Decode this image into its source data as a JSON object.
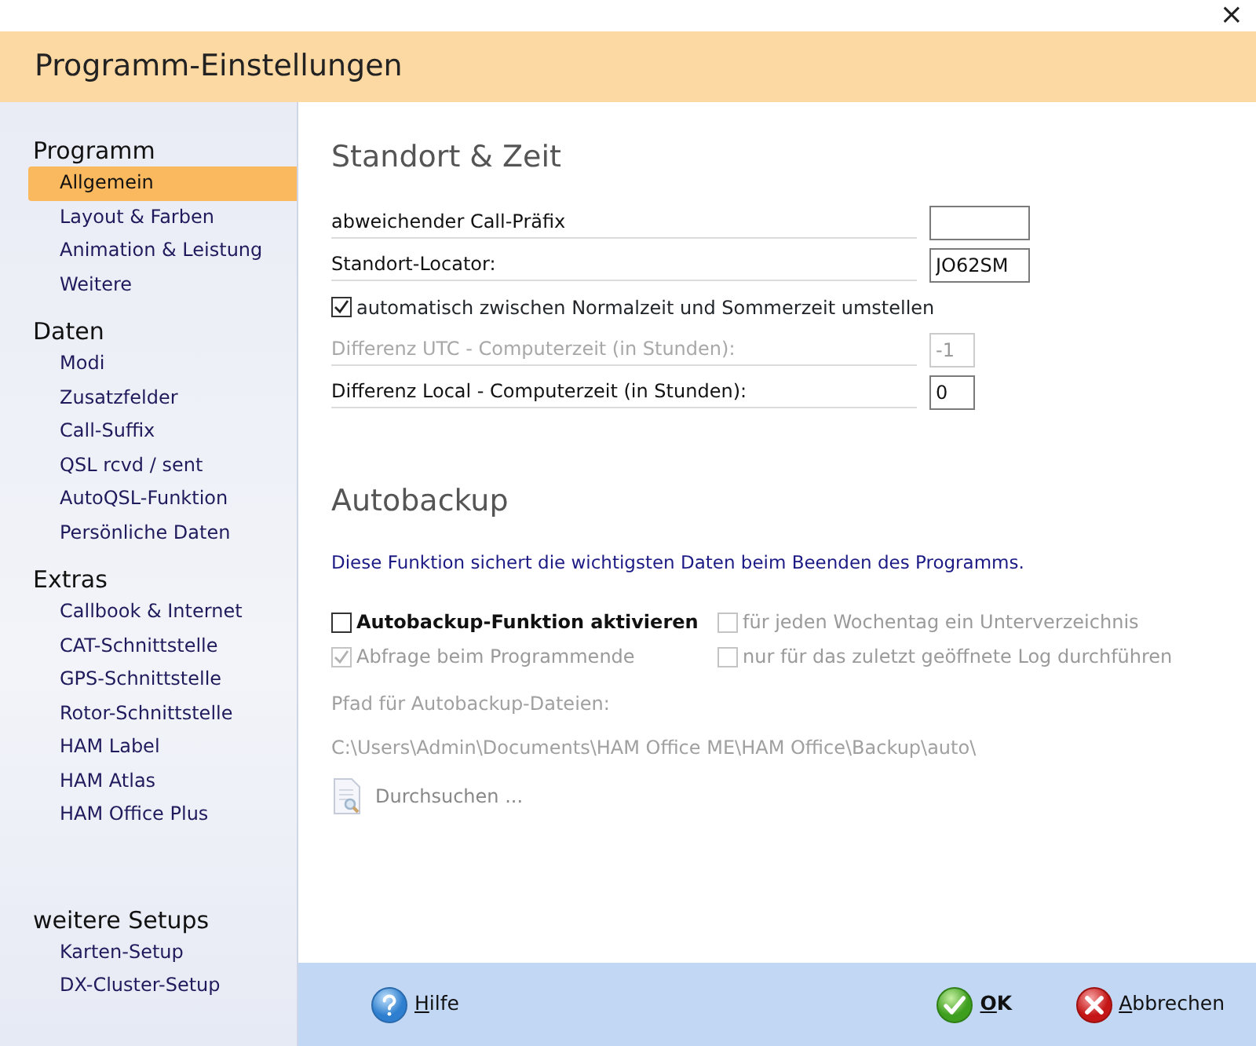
{
  "window": {
    "close_glyph": "×",
    "title": "Programm-Einstellungen"
  },
  "sidebar": {
    "groups": [
      {
        "heading": "Programm",
        "items": [
          {
            "label": "Allgemein",
            "selected": true
          },
          {
            "label": "Layout & Farben",
            "selected": false
          },
          {
            "label": "Animation & Leistung",
            "selected": false
          },
          {
            "label": "Weitere",
            "selected": false
          }
        ]
      },
      {
        "heading": "Daten",
        "items": [
          {
            "label": "Modi",
            "selected": false
          },
          {
            "label": "Zusatzfelder",
            "selected": false
          },
          {
            "label": "Call-Suffix",
            "selected": false
          },
          {
            "label": "QSL rcvd / sent",
            "selected": false
          },
          {
            "label": "AutoQSL-Funktion",
            "selected": false
          },
          {
            "label": "Persönliche Daten",
            "selected": false
          }
        ]
      },
      {
        "heading": "Extras",
        "items": [
          {
            "label": "Callbook & Internet",
            "selected": false
          },
          {
            "label": "CAT-Schnittstelle",
            "selected": false
          },
          {
            "label": "GPS-Schnittstelle",
            "selected": false
          },
          {
            "label": "Rotor-Schnittstelle",
            "selected": false
          },
          {
            "label": "HAM Label",
            "selected": false
          },
          {
            "label": "HAM Atlas",
            "selected": false
          },
          {
            "label": "HAM Office Plus",
            "selected": false
          }
        ]
      },
      {
        "heading": "weitere Setups",
        "items": [
          {
            "label": "Karten-Setup",
            "selected": false
          },
          {
            "label": "DX-Cluster-Setup",
            "selected": false
          }
        ]
      }
    ]
  },
  "standort": {
    "heading": "Standort & Zeit",
    "rows": [
      {
        "kind": "text",
        "label": "abweichender Call-Präfix",
        "disabled": false
      },
      {
        "kind": "text",
        "label": "Standort-Locator:",
        "value": "JO62SM",
        "disabled": false
      },
      {
        "kind": "checkbox",
        "label": "automatisch zwischen Normalzeit und Sommerzeit umstellen",
        "checked": true,
        "disabled": false
      },
      {
        "kind": "number",
        "label": "Differenz UTC - Computerzeit (in Stunden):",
        "value": "-1",
        "disabled": true
      },
      {
        "kind": "number",
        "label": "Differenz Local - Computerzeit (in Stunden):",
        "value": "0",
        "disabled": false
      }
    ]
  },
  "autobackup": {
    "heading": "Autobackup",
    "intro": "Diese Funktion sichert die wichtigsten Daten beim Beenden des Programms.",
    "options": [
      {
        "label": "Autobackup-Funktion aktivieren",
        "checked": false,
        "disabled": false,
        "bold": true
      },
      {
        "label": "für jeden Wochentag  ein Unterverzeichnis",
        "checked": false,
        "disabled": true,
        "bold": false
      },
      {
        "label": "Abfrage beim Programmende",
        "checked": true,
        "disabled": true,
        "bold": false
      },
      {
        "label": "nur für das zuletzt geöffnete Log durchführen",
        "checked": false,
        "disabled": true,
        "bold": false
      }
    ],
    "path_label": "Pfad für Autobackup-Dateien:",
    "path": "C:\\Users\\Admin\\Documents\\HAM Office ME\\HAM Office\\Backup\\auto\\",
    "browse_label": "Durchsuchen ...",
    "disabled": true
  },
  "footer": {
    "buttons": [
      {
        "kind": "help",
        "label": "Hilfe",
        "default": false
      },
      {
        "kind": "ok",
        "label": "OK",
        "default": true
      },
      {
        "kind": "cancel",
        "label": "Abbrechen",
        "default": false
      }
    ]
  }
}
